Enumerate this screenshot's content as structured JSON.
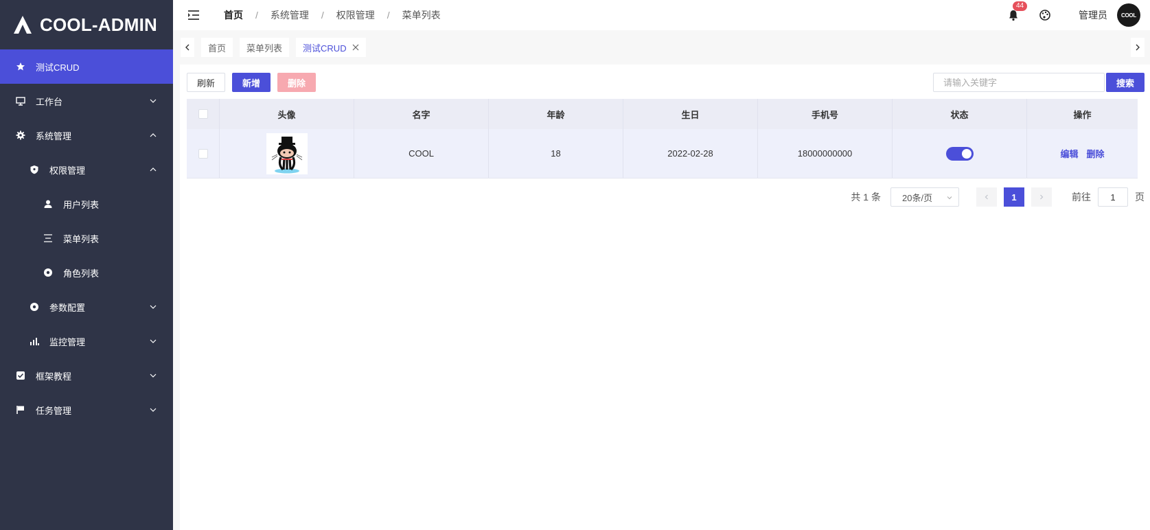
{
  "brand": {
    "name": "COOL-ADMIN"
  },
  "sidebar": {
    "items": [
      {
        "label": "测试CRUD",
        "icon": "star-icon",
        "active": true
      },
      {
        "label": "工作台",
        "icon": "monitor-icon",
        "arrow": "down"
      },
      {
        "label": "系统管理",
        "icon": "gear-icon",
        "arrow": "up"
      },
      {
        "label": "权限管理",
        "icon": "shield-icon",
        "arrow": "up"
      },
      {
        "label": "用户列表",
        "icon": "user-icon"
      },
      {
        "label": "菜单列表",
        "icon": "menu-lines-icon"
      },
      {
        "label": "角色列表",
        "icon": "circle-dot-icon"
      },
      {
        "label": "参数配置",
        "icon": "circle-dot-icon",
        "arrow": "down"
      },
      {
        "label": "监控管理",
        "icon": "bar-chart-icon",
        "arrow": "down"
      },
      {
        "label": "框架教程",
        "icon": "checkbox-icon",
        "arrow": "down"
      },
      {
        "label": "任务管理",
        "icon": "flag-icon",
        "arrow": "down"
      }
    ]
  },
  "header": {
    "breadcrumb": [
      "首页",
      "系统管理",
      "权限管理",
      "菜单列表"
    ],
    "separator": "/",
    "notification_count": "44",
    "username": "管理员",
    "avatar_text": "COOL"
  },
  "tabs": [
    {
      "label": "首页"
    },
    {
      "label": "菜单列表"
    },
    {
      "label": "测试CRUD",
      "active": true
    }
  ],
  "toolbar": {
    "refresh_label": "刷新",
    "add_label": "新增",
    "delete_label": "删除",
    "search_placeholder": "请输入关键字",
    "search_label": "搜索"
  },
  "table": {
    "headers": [
      "头像",
      "名字",
      "年龄",
      "生日",
      "手机号",
      "状态",
      "操作"
    ],
    "rows": [
      {
        "name": "COOL",
        "age": "18",
        "birthday": "2022-02-28",
        "phone": "18000000000",
        "status": true,
        "edit": "编辑",
        "delete": "删除"
      }
    ]
  },
  "pagination": {
    "total_text": "共 1 条",
    "page_size": "20条/页",
    "current_page": "1",
    "goto_label": "前往",
    "goto_value": "1",
    "goto_suffix": "页"
  },
  "colors": {
    "sidebar_bg": "#2f3447",
    "accent": "#4b4fd9",
    "danger_disabled": "#f7a9b0",
    "badge": "#e6505b"
  }
}
